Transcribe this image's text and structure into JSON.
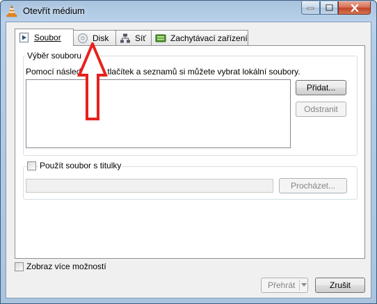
{
  "window": {
    "title": "Otevřít médium"
  },
  "tabs": [
    {
      "label": "Soubor",
      "icon": "play-file-icon",
      "active": true
    },
    {
      "label": "Disk",
      "icon": "disc-icon",
      "active": false
    },
    {
      "label": "Síť",
      "icon": "network-icon",
      "active": false
    },
    {
      "label": "Zachytávací zařízení",
      "icon": "capture-device-icon",
      "active": false
    }
  ],
  "file_selection": {
    "group_label": "Výběr souboru",
    "description": "Pomocí následujících tlačítek a seznamů si můžete vybrat lokální soubory.",
    "add_button": "Přidat...",
    "remove_button": "Odstranit"
  },
  "subtitles": {
    "checkbox_label": "Použít soubor s titulky",
    "browse_button": "Procházet..."
  },
  "footer": {
    "more_options_label": "Zobraz více možností",
    "play_button": "Přehrát",
    "cancel_button": "Zrušit"
  },
  "colors": {
    "annotation_arrow": "#e8201c"
  }
}
